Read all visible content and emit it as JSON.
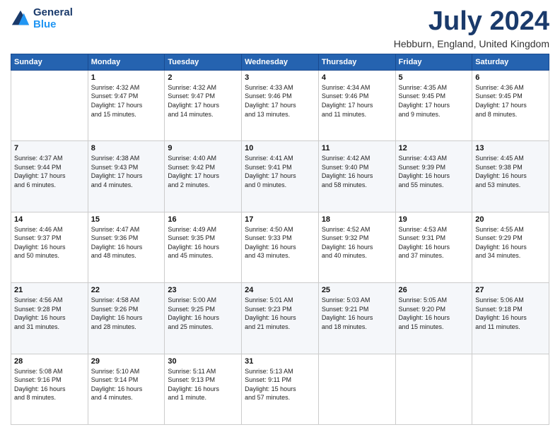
{
  "header": {
    "logo_line1": "General",
    "logo_line2": "Blue",
    "title": "July 2024",
    "subtitle": "Hebburn, England, United Kingdom"
  },
  "weekdays": [
    "Sunday",
    "Monday",
    "Tuesday",
    "Wednesday",
    "Thursday",
    "Friday",
    "Saturday"
  ],
  "weeks": [
    [
      {
        "day": "",
        "info": ""
      },
      {
        "day": "1",
        "info": "Sunrise: 4:32 AM\nSunset: 9:47 PM\nDaylight: 17 hours\nand 15 minutes."
      },
      {
        "day": "2",
        "info": "Sunrise: 4:32 AM\nSunset: 9:47 PM\nDaylight: 17 hours\nand 14 minutes."
      },
      {
        "day": "3",
        "info": "Sunrise: 4:33 AM\nSunset: 9:46 PM\nDaylight: 17 hours\nand 13 minutes."
      },
      {
        "day": "4",
        "info": "Sunrise: 4:34 AM\nSunset: 9:46 PM\nDaylight: 17 hours\nand 11 minutes."
      },
      {
        "day": "5",
        "info": "Sunrise: 4:35 AM\nSunset: 9:45 PM\nDaylight: 17 hours\nand 9 minutes."
      },
      {
        "day": "6",
        "info": "Sunrise: 4:36 AM\nSunset: 9:45 PM\nDaylight: 17 hours\nand 8 minutes."
      }
    ],
    [
      {
        "day": "7",
        "info": "Sunrise: 4:37 AM\nSunset: 9:44 PM\nDaylight: 17 hours\nand 6 minutes."
      },
      {
        "day": "8",
        "info": "Sunrise: 4:38 AM\nSunset: 9:43 PM\nDaylight: 17 hours\nand 4 minutes."
      },
      {
        "day": "9",
        "info": "Sunrise: 4:40 AM\nSunset: 9:42 PM\nDaylight: 17 hours\nand 2 minutes."
      },
      {
        "day": "10",
        "info": "Sunrise: 4:41 AM\nSunset: 9:41 PM\nDaylight: 17 hours\nand 0 minutes."
      },
      {
        "day": "11",
        "info": "Sunrise: 4:42 AM\nSunset: 9:40 PM\nDaylight: 16 hours\nand 58 minutes."
      },
      {
        "day": "12",
        "info": "Sunrise: 4:43 AM\nSunset: 9:39 PM\nDaylight: 16 hours\nand 55 minutes."
      },
      {
        "day": "13",
        "info": "Sunrise: 4:45 AM\nSunset: 9:38 PM\nDaylight: 16 hours\nand 53 minutes."
      }
    ],
    [
      {
        "day": "14",
        "info": "Sunrise: 4:46 AM\nSunset: 9:37 PM\nDaylight: 16 hours\nand 50 minutes."
      },
      {
        "day": "15",
        "info": "Sunrise: 4:47 AM\nSunset: 9:36 PM\nDaylight: 16 hours\nand 48 minutes."
      },
      {
        "day": "16",
        "info": "Sunrise: 4:49 AM\nSunset: 9:35 PM\nDaylight: 16 hours\nand 45 minutes."
      },
      {
        "day": "17",
        "info": "Sunrise: 4:50 AM\nSunset: 9:33 PM\nDaylight: 16 hours\nand 43 minutes."
      },
      {
        "day": "18",
        "info": "Sunrise: 4:52 AM\nSunset: 9:32 PM\nDaylight: 16 hours\nand 40 minutes."
      },
      {
        "day": "19",
        "info": "Sunrise: 4:53 AM\nSunset: 9:31 PM\nDaylight: 16 hours\nand 37 minutes."
      },
      {
        "day": "20",
        "info": "Sunrise: 4:55 AM\nSunset: 9:29 PM\nDaylight: 16 hours\nand 34 minutes."
      }
    ],
    [
      {
        "day": "21",
        "info": "Sunrise: 4:56 AM\nSunset: 9:28 PM\nDaylight: 16 hours\nand 31 minutes."
      },
      {
        "day": "22",
        "info": "Sunrise: 4:58 AM\nSunset: 9:26 PM\nDaylight: 16 hours\nand 28 minutes."
      },
      {
        "day": "23",
        "info": "Sunrise: 5:00 AM\nSunset: 9:25 PM\nDaylight: 16 hours\nand 25 minutes."
      },
      {
        "day": "24",
        "info": "Sunrise: 5:01 AM\nSunset: 9:23 PM\nDaylight: 16 hours\nand 21 minutes."
      },
      {
        "day": "25",
        "info": "Sunrise: 5:03 AM\nSunset: 9:21 PM\nDaylight: 16 hours\nand 18 minutes."
      },
      {
        "day": "26",
        "info": "Sunrise: 5:05 AM\nSunset: 9:20 PM\nDaylight: 16 hours\nand 15 minutes."
      },
      {
        "day": "27",
        "info": "Sunrise: 5:06 AM\nSunset: 9:18 PM\nDaylight: 16 hours\nand 11 minutes."
      }
    ],
    [
      {
        "day": "28",
        "info": "Sunrise: 5:08 AM\nSunset: 9:16 PM\nDaylight: 16 hours\nand 8 minutes."
      },
      {
        "day": "29",
        "info": "Sunrise: 5:10 AM\nSunset: 9:14 PM\nDaylight: 16 hours\nand 4 minutes."
      },
      {
        "day": "30",
        "info": "Sunrise: 5:11 AM\nSunset: 9:13 PM\nDaylight: 16 hours\nand 1 minute."
      },
      {
        "day": "31",
        "info": "Sunrise: 5:13 AM\nSunset: 9:11 PM\nDaylight: 15 hours\nand 57 minutes."
      },
      {
        "day": "",
        "info": ""
      },
      {
        "day": "",
        "info": ""
      },
      {
        "day": "",
        "info": ""
      }
    ]
  ]
}
